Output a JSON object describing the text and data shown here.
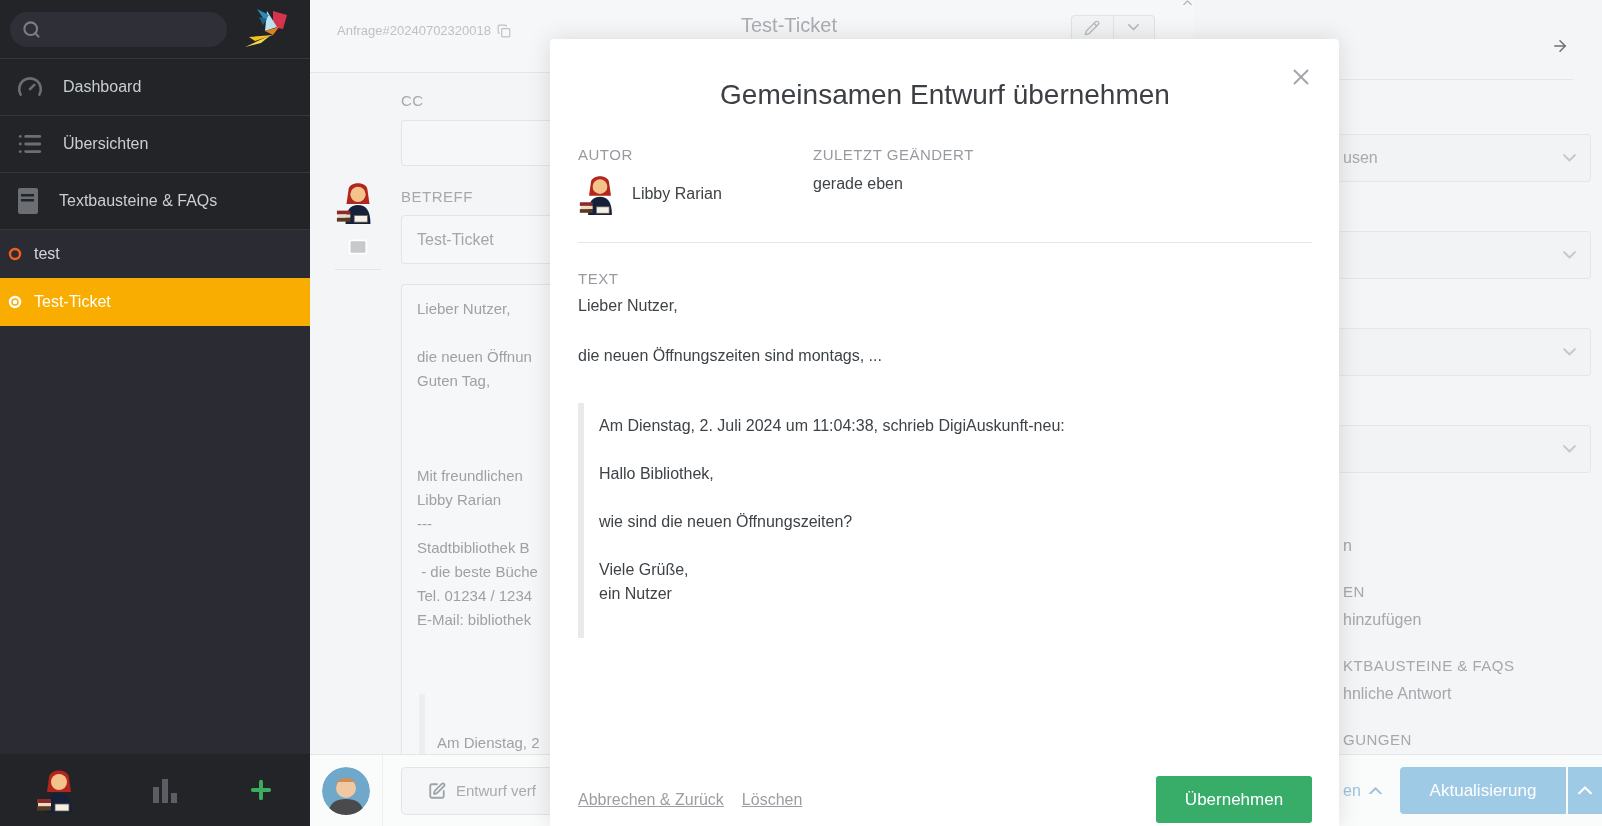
{
  "sidebar": {
    "nav": [
      {
        "label": "Dashboard",
        "kind": "gauge"
      },
      {
        "label": "Übersichten",
        "kind": "list"
      },
      {
        "label": "Textbausteine & FAQs",
        "kind": "book"
      }
    ],
    "tickets": [
      {
        "title": "test",
        "selected": false
      },
      {
        "title": "Test-Ticket",
        "selected": true
      }
    ]
  },
  "ticket": {
    "id": "Anfrage#20240702320018",
    "title": "Test-Ticket",
    "cc_label": "CC",
    "subject_label": "BETREFF",
    "subject": "Test-Ticket",
    "body": [
      [
        "Lieber Nutzer,"
      ],
      [
        "die neuen Öffnun",
        "Guten Tag,"
      ],
      [
        "Mit freundlichen",
        "Libby Rarian",
        "---",
        "Stadtbibliothek B",
        " - die beste Büche",
        "Tel. 01234 / 1234",
        "E-Mail: bibliothek"
      ]
    ],
    "quote": [
      "Am Dienstag, 2"
    ],
    "draft_button": "Entwurf verf"
  },
  "side_panel": {
    "selects": [
      {
        "kind": "filled",
        "value": "usen"
      },
      {
        "kind": "empty"
      },
      {
        "kind": "empty"
      },
      {
        "kind": "empty"
      }
    ],
    "fragments": [
      {
        "kind": "text",
        "text": "n"
      },
      {
        "kind": "label",
        "text": "EN"
      },
      {
        "kind": "text",
        "text": "hinzufügen"
      },
      {
        "kind": "label",
        "text": "KTBAUSTEINE & FAQS"
      },
      {
        "kind": "text",
        "text": "hnliche Antwort"
      },
      {
        "kind": "label",
        "text": "GUNGEN"
      }
    ],
    "toggle": "en",
    "primary_button": "Aktualisierung"
  },
  "modal": {
    "title": "Gemeinsamen Entwurf übernehmen",
    "author_label": "AUTOR",
    "author": "Libby Rarian",
    "changed_label": "ZULETZT GEÄNDERT",
    "changed": "gerade eben",
    "text_label": "TEXT",
    "paragraphs": [
      "Lieber Nutzer,",
      "die neuen Öffnungszeiten sind montags, ..."
    ],
    "quote": [
      [
        "Am Dienstag, 2. Juli 2024 um 11:04:38, schrieb DigiAuskunft-neu:"
      ],
      [
        "Hallo Bibliothek,"
      ],
      [
        "wie sind die neuen Öffnungszeiten?"
      ],
      [
        "Viele Grüße,",
        "ein Nutzer"
      ]
    ],
    "links": [
      "Abbrechen & Zurück",
      "Löschen"
    ],
    "confirm_button": "Übernehmen"
  }
}
